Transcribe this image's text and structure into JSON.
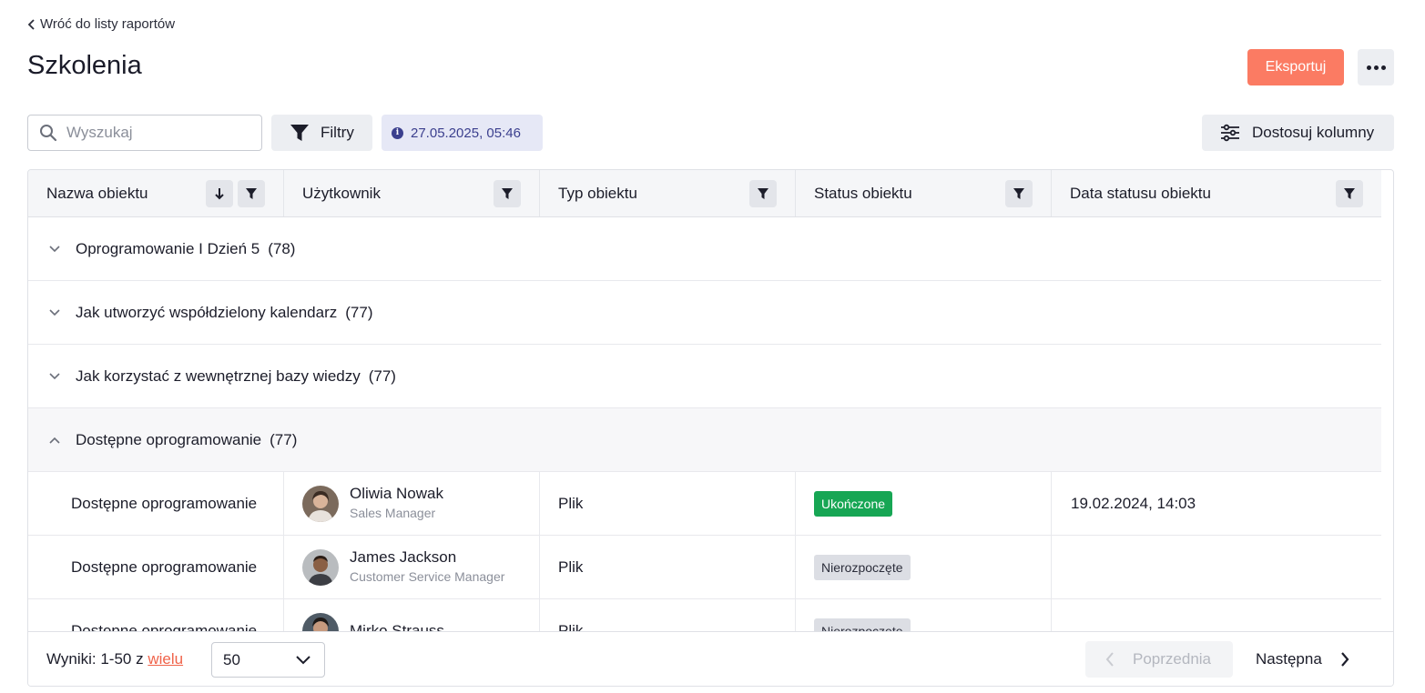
{
  "back_link": {
    "label": "Wróć do listy raportów"
  },
  "page_title": "Szkolenia",
  "actions": {
    "export_label": "Eksportuj"
  },
  "toolbar": {
    "search_placeholder": "Wyszukaj",
    "filters_label": "Filtry",
    "snapshot_date": "27.05.2025, 05:46",
    "columns_label": "Dostosuj kolumny"
  },
  "table": {
    "columns": [
      "Nazwa obiektu",
      "Użytkownik",
      "Typ obiektu",
      "Status obiektu",
      "Data statusu obiektu"
    ],
    "groups": [
      {
        "name": "Oprogramowanie I Dzień 5",
        "count": "(78)",
        "expanded": false
      },
      {
        "name": "Jak utworzyć współdzielony kalendarz",
        "count": "(77)",
        "expanded": false
      },
      {
        "name": "Jak korzystać z wewnętrznej bazy wiedzy",
        "count": "(77)",
        "expanded": false
      },
      {
        "name": "Dostępne oprogramowanie",
        "count": "(77)",
        "expanded": true
      }
    ],
    "rows": [
      {
        "object": "Dostępne oprogramowanie",
        "user_name": "Oliwia Nowak",
        "user_role": "Sales Manager",
        "type": "Plik",
        "status": "Ukończone",
        "status_kind": "done",
        "status_date": "19.02.2024, 14:03"
      },
      {
        "object": "Dostępne oprogramowanie",
        "user_name": "James Jackson",
        "user_role": "Customer Service Manager",
        "type": "Plik",
        "status": "Nierozpoczęte",
        "status_kind": "todo",
        "status_date": ""
      },
      {
        "object": "Dostępne oprogramowanie",
        "user_name": "Mirko Strauss",
        "user_role": "",
        "type": "Plik",
        "status": "Nierozpoczęte",
        "status_kind": "todo",
        "status_date": ""
      }
    ]
  },
  "footer": {
    "results_prefix": "Wyniki: 1-50 z ",
    "results_link": "wielu",
    "page_size": "50",
    "prev_label": "Poprzednia",
    "next_label": "Następna"
  },
  "colors": {
    "accent": "#fb7b63",
    "success": "#17a654",
    "link": "#f0634a",
    "info": "#3b3f8e"
  }
}
